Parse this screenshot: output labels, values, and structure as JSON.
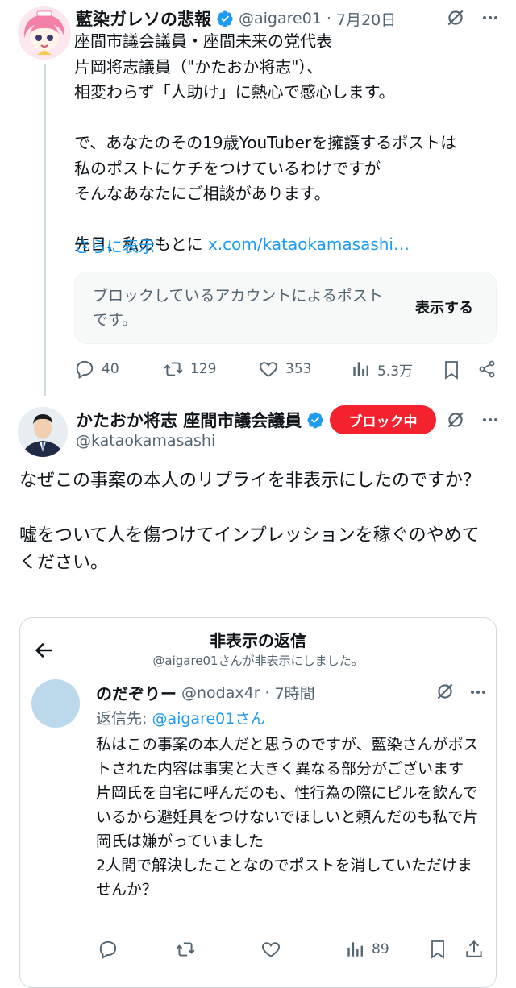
{
  "tweet1": {
    "name": "藍染ガレソの悲報",
    "handle": "@aigare01",
    "sep": "·",
    "date": "7月20日",
    "body": "座間市議会議員・座間未来の党代表\n片岡将志議員（\"かたおか将志\"）、\n相変わらず「人助け」に熱心で感心します。\n\nで、あなたのその19歳YouTuberを擁護するポストは\n私のポストにケチをつけているわけですが\nそんなあなたにご相談があります。\n\n先日、私のもとに ",
    "body_link": "x.com/kataokamasashi…",
    "show_more": "さらに表示",
    "blocked_text": "ブロックしているアカウントによるポストです。",
    "blocked_show": "表示する",
    "replies": "40",
    "reposts": "129",
    "likes": "353",
    "views": "5.3万"
  },
  "tweet2": {
    "name": "かたおか将志 座間市議会議員",
    "handle": "@kataokamasashi",
    "blocked_badge": "ブロック中",
    "body": "なぜこの事案の本人のリプライを非表示にしたのですか？\n\n嘘をついて人を傷つけてインプレッションを稼ぐのやめてください。"
  },
  "quote": {
    "header_title": "非表示の返信",
    "header_sub": "@aigare01さんが非表示にしました。",
    "name": "のだぞりー",
    "handle": "@nodax4r",
    "sep": "·",
    "time": "7時間",
    "reply_prefix": "返信先: ",
    "reply_to": "@aigare01さん",
    "body": "私はこの事案の本人だと思うのですが、藍染さんがポストされた内容は事実と大きく異なる部分がございます\n片岡氏を自宅に呼んだのも、性行為の際にピルを飲んでいるから避妊具をつけないでほしいと頼んだのも私で片岡氏は嫌がっていました\n2人間で解決したことなのでポストを消していただけませんか？",
    "views": "89"
  },
  "colors": {
    "accent": "#1d9bf0",
    "text": "#0f1419",
    "muted": "#536471",
    "block_red": "#f4212e"
  }
}
